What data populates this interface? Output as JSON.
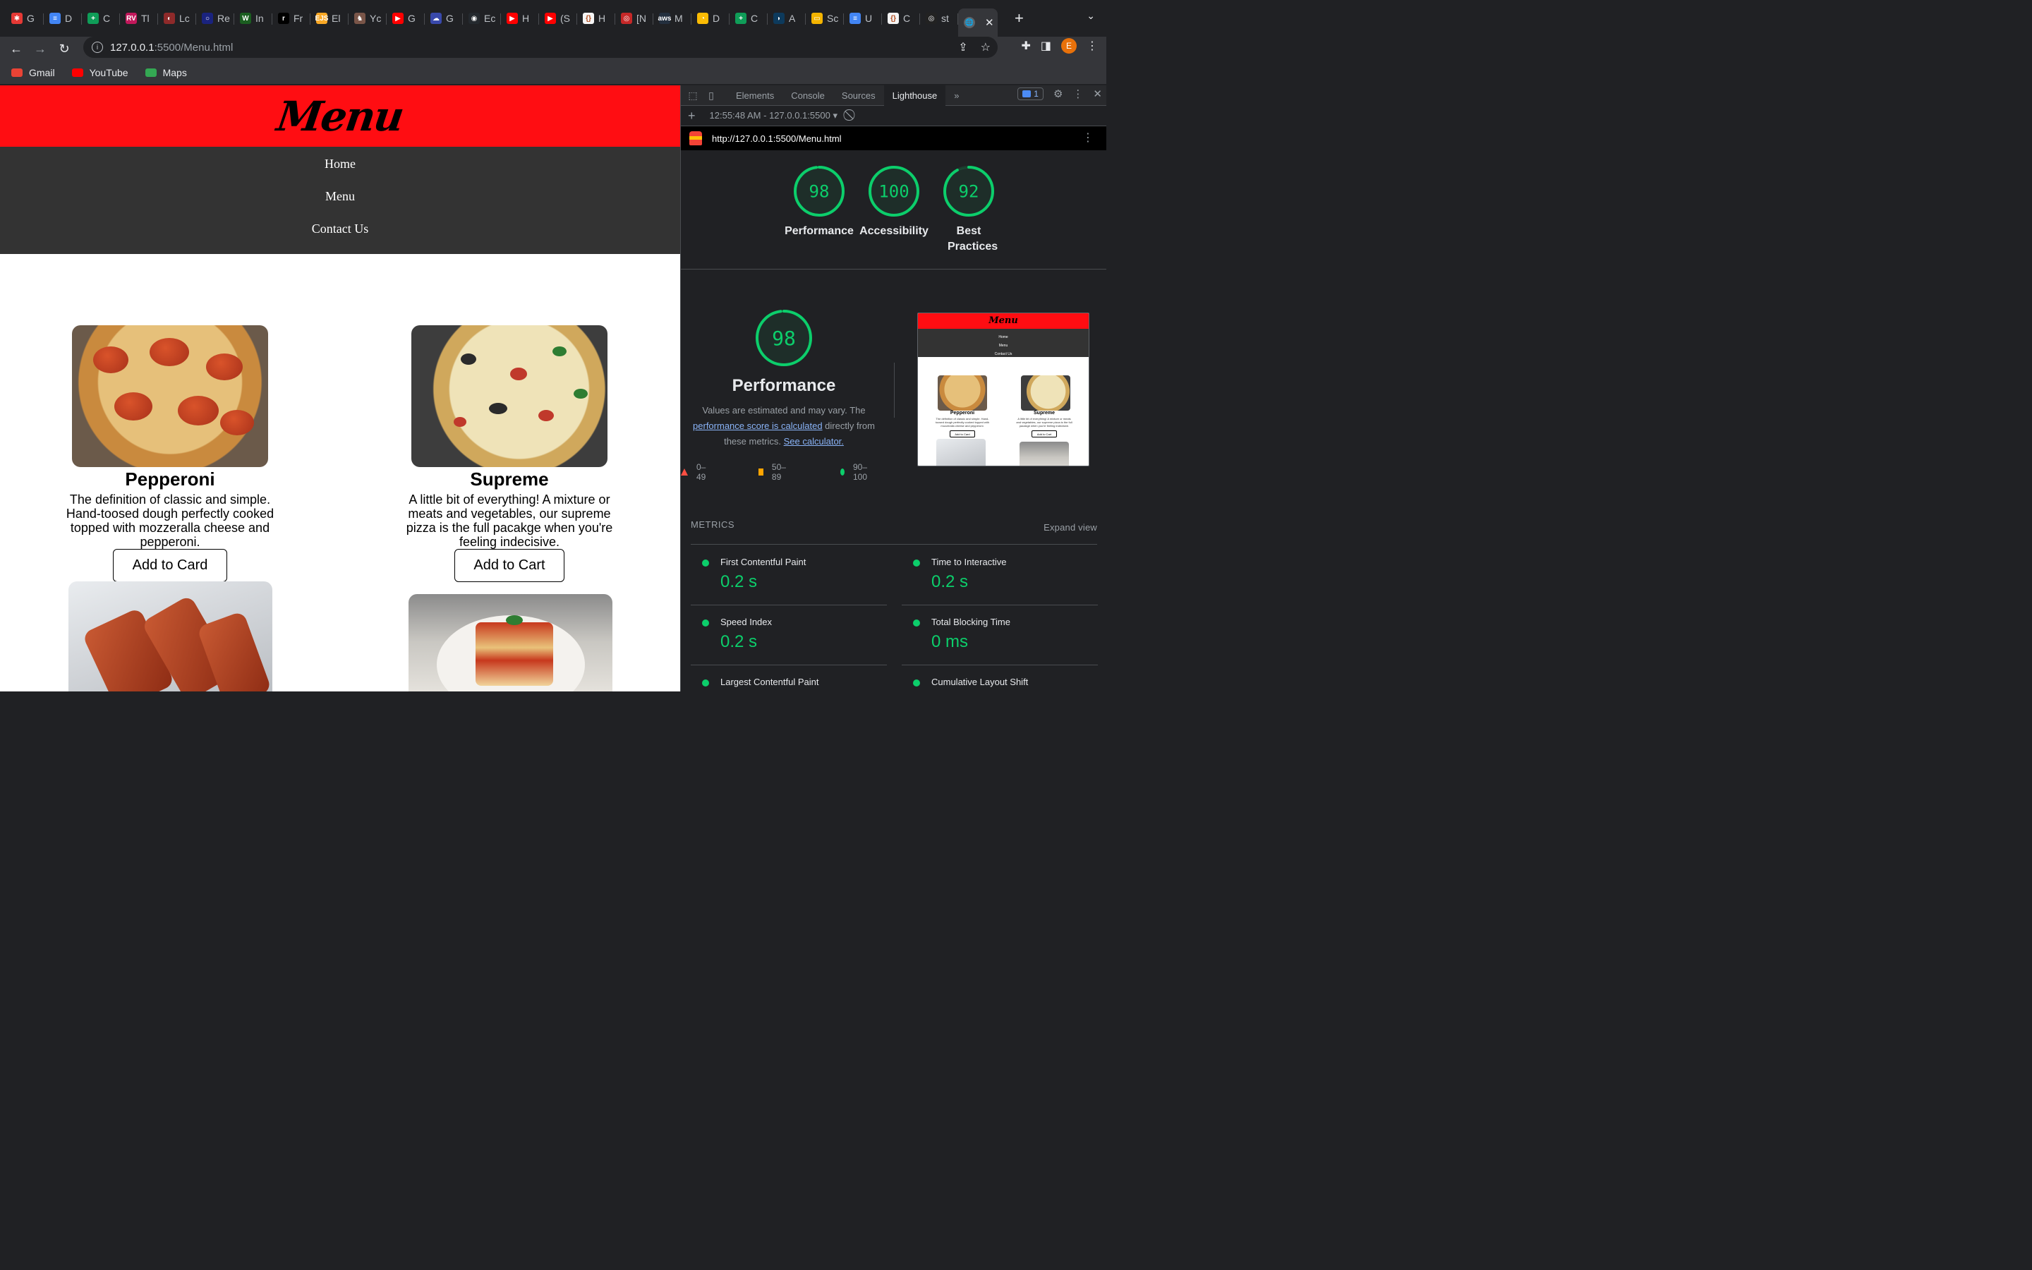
{
  "browser": {
    "tabs": [
      {
        "title": "G",
        "color": "#e53935",
        "glyph": "✱"
      },
      {
        "title": "D",
        "color": "#4285f4",
        "glyph": "≡"
      },
      {
        "title": "C",
        "color": "#0f9d58",
        "glyph": "+"
      },
      {
        "title": "Tl",
        "color": "#c2185b",
        "glyph": "RV"
      },
      {
        "title": "Lc",
        "color": "#8e2a2a",
        "glyph": "◐"
      },
      {
        "title": "Re",
        "color": "#1a237e",
        "glyph": "○"
      },
      {
        "title": "In",
        "color": "#1b5e20",
        "glyph": "W"
      },
      {
        "title": "Fr",
        "color": "#000000",
        "glyph": "r"
      },
      {
        "title": "El",
        "color": "#f9a825",
        "glyph": "EJS"
      },
      {
        "title": "Yc",
        "color": "#795548",
        "glyph": "♞"
      },
      {
        "title": "G",
        "color": "#ff0000",
        "glyph": "▶"
      },
      {
        "title": "G",
        "color": "#3949ab",
        "glyph": "☁"
      },
      {
        "title": "Ec",
        "color": "#24292e",
        "glyph": "◉"
      },
      {
        "title": "H",
        "color": "#ff0000",
        "glyph": "▶"
      },
      {
        "title": "(S",
        "color": "#ff0000",
        "glyph": "▶"
      },
      {
        "title": "H",
        "color": "#f5f5f5",
        "glyph": "{}"
      },
      {
        "title": "[N",
        "color": "#c62828",
        "glyph": "◎"
      },
      {
        "title": "M",
        "color": "#232f3e",
        "glyph": "aws"
      },
      {
        "title": "D",
        "color": "#fbbc04",
        "glyph": "◔"
      },
      {
        "title": "C",
        "color": "#0f9d58",
        "glyph": "+"
      },
      {
        "title": "A",
        "color": "#0d3a5c",
        "glyph": "◗"
      },
      {
        "title": "Sc",
        "color": "#f4b400",
        "glyph": "▭"
      },
      {
        "title": "U",
        "color": "#4285f4",
        "glyph": "≡"
      },
      {
        "title": "C",
        "color": "#f5f5f5",
        "glyph": "{}"
      },
      {
        "title": "st",
        "color": "#222222",
        "glyph": "◎"
      }
    ],
    "active_tab_glyph": "🌐",
    "new_tab": "+",
    "url_host": "127.0.0.1",
    "url_path": ":5500/Menu.html",
    "avatar_letter": "E",
    "bookmarks": [
      {
        "label": "Gmail",
        "color": "#ea4335"
      },
      {
        "label": "YouTube",
        "color": "#ff0000"
      },
      {
        "label": "Maps",
        "color": "#34a853"
      }
    ]
  },
  "page": {
    "title": "Menu",
    "nav": [
      "Home",
      "Menu",
      "Contact Us"
    ],
    "items": [
      {
        "name": "Pepperoni",
        "description": "The definition of classic and simple. Hand-toosed dough perfectly cooked topped with mozzeralla cheese and pepperoni.",
        "button": "Add to Card"
      },
      {
        "name": "Supreme",
        "description": "A little bit of everything! A mixture or meats and vegetables, our supreme pizza is the full pacakge when you're feeling indecisive.",
        "button": "Add to Cart"
      }
    ]
  },
  "devtools": {
    "tabs": [
      "Elements",
      "Console",
      "Sources",
      "Lighthouse"
    ],
    "active_tab": "Lighthouse",
    "more": "»",
    "issues_count": "1",
    "report_time": "12:55:48 AM - 127.0.0.1:5500",
    "report_url": "http://127.0.0.1:5500/Menu.html",
    "scores": [
      {
        "label": "Performance",
        "value": 98
      },
      {
        "label": "Accessibility",
        "value": 100
      },
      {
        "label": "Best Practices",
        "value": 92
      }
    ],
    "performance": {
      "score": 98,
      "title": "Performance",
      "desc_prefix": "Values are estimated and may vary. The ",
      "link1": "performance score is calculated",
      "desc_mid": " directly from these metrics. ",
      "link2": "See calculator."
    },
    "legend": [
      {
        "range": "0–49",
        "color": "#ff4e42"
      },
      {
        "range": "50–89",
        "color": "#ffa400"
      },
      {
        "range": "90–100",
        "color": "#0cce6b"
      }
    ],
    "thumbnail": {
      "title": "Menu",
      "nav": [
        "Home",
        "Menu",
        "Contact Us"
      ],
      "item1": "Pepperoni",
      "item2": "Supreme",
      "item1_text": "The definition of classic and simple. Hand-toosed dough perfectly cooked topped with mozzeralla cheese and pepperoni.",
      "item2_text": "A little bit of everything! A mixture or meats and vegetables, our supreme pizza is the full pacakge when you're feeling indecisive.",
      "btn1": "Add to Card",
      "btn2": "Add to Cart"
    },
    "metrics_header": "METRICS",
    "expand": "Expand view",
    "metrics": [
      {
        "label": "First Contentful Paint",
        "value": "0.2 s"
      },
      {
        "label": "Time to Interactive",
        "value": "0.2 s"
      },
      {
        "label": "Speed Index",
        "value": "0.2 s"
      },
      {
        "label": "Total Blocking Time",
        "value": "0 ms"
      },
      {
        "label": "Largest Contentful Paint",
        "value": ""
      },
      {
        "label": "Cumulative Layout Shift",
        "value": ""
      }
    ],
    "good_color": "#0cce6b"
  }
}
